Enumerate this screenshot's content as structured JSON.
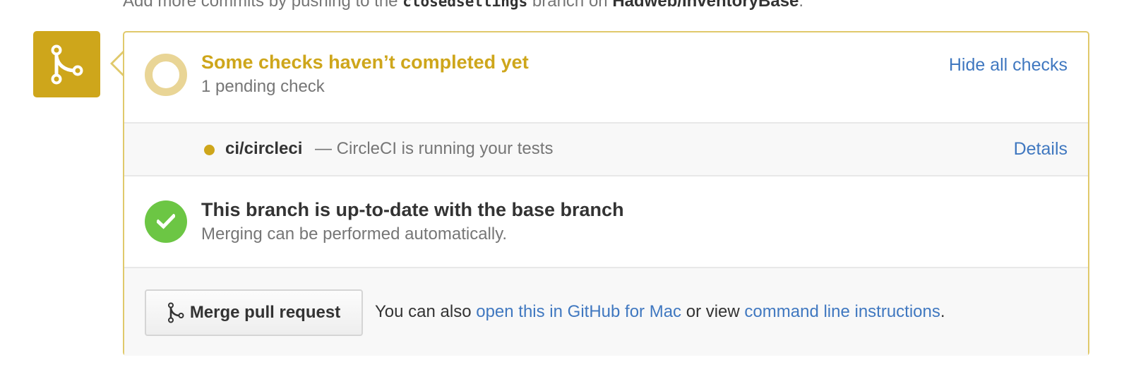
{
  "top_note": {
    "prefix": "Add more commits by pushing to the",
    "branch": "closedsettings",
    "middle": "branch on",
    "repo": "Hadweb/InventoryBase",
    "suffix": "."
  },
  "checks": {
    "heading": "Some checks haven’t completed yet",
    "subtext": "1 pending check",
    "hide_link": "Hide all checks"
  },
  "ci_check": {
    "name": "ci/circleci",
    "description": "— CircleCI is running your tests",
    "details_link": "Details",
    "status_color": "#cea61b"
  },
  "branch_status": {
    "heading": "This branch is up-to-date with the base branch",
    "subtext": "Merging can be performed automatically."
  },
  "merge": {
    "button_label": "Merge pull request",
    "text_prefix": "You can also",
    "mac_link": "open this in GitHub for Mac",
    "text_middle": "or view",
    "cli_link": "command line instructions",
    "text_suffix": "."
  },
  "colors": {
    "pending": "#cea61b",
    "success": "#6cc644",
    "link": "#4078c0"
  },
  "icons": {
    "badge": "git-merge-icon",
    "success": "check-icon",
    "pending": "pending-ring-icon",
    "button": "git-merge-icon"
  }
}
